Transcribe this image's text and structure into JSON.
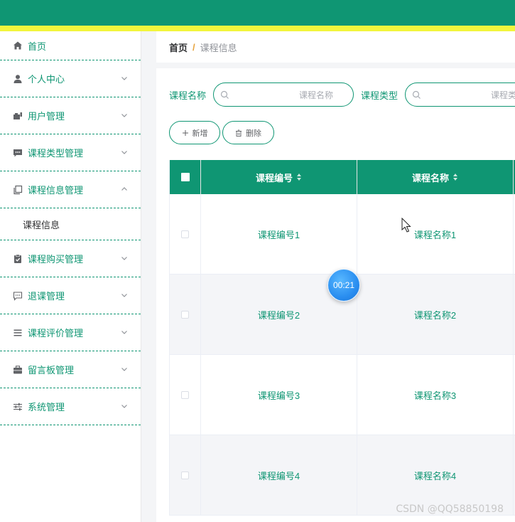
{
  "colors": {
    "primary": "#0f9673",
    "accent_stripe": "#f2f53d",
    "breadcrumb_separator": "#e6a23c",
    "timer": "#2a8ef0"
  },
  "sidebar": {
    "items": [
      {
        "label": "首页",
        "icon": "home-icon",
        "expandable": false
      },
      {
        "label": "个人中心",
        "icon": "user-icon",
        "expandable": true
      },
      {
        "label": "用户管理",
        "icon": "user-manage-icon",
        "expandable": true
      },
      {
        "label": "课程类型管理",
        "icon": "chat-box-icon",
        "expandable": true
      },
      {
        "label": "课程信息管理",
        "icon": "copy-document-icon",
        "expandable": true,
        "expanded": true,
        "children": [
          "课程信息"
        ]
      },
      {
        "label": "课程购买管理",
        "icon": "clipboard-check-icon",
        "expandable": true
      },
      {
        "label": "退课管理",
        "icon": "chat-dots-icon",
        "expandable": true
      },
      {
        "label": "课程评价管理",
        "icon": "list-icon",
        "expandable": true
      },
      {
        "label": "留言板管理",
        "icon": "briefcase-icon",
        "expandable": true
      },
      {
        "label": "系统管理",
        "icon": "sliders-icon",
        "expandable": true
      }
    ]
  },
  "breadcrumb": {
    "home": "首页",
    "separator": "/",
    "current": "课程信息"
  },
  "search": {
    "fields": [
      {
        "label": "课程名称",
        "placeholder": "课程名称",
        "value": ""
      },
      {
        "label": "课程类型",
        "placeholder": "课程类型",
        "value": ""
      }
    ]
  },
  "actions": {
    "add_label": "新增",
    "delete_label": "删除"
  },
  "table": {
    "columns": [
      "课程编号",
      "课程名称"
    ],
    "rows": [
      [
        "课程编号1",
        "课程名称1"
      ],
      [
        "课程编号2",
        "课程名称2"
      ],
      [
        "课程编号3",
        "课程名称3"
      ],
      [
        "课程编号4",
        "课程名称4"
      ]
    ]
  },
  "overlay": {
    "timer": "00:21",
    "watermark": "CSDN @QQ58850198"
  }
}
